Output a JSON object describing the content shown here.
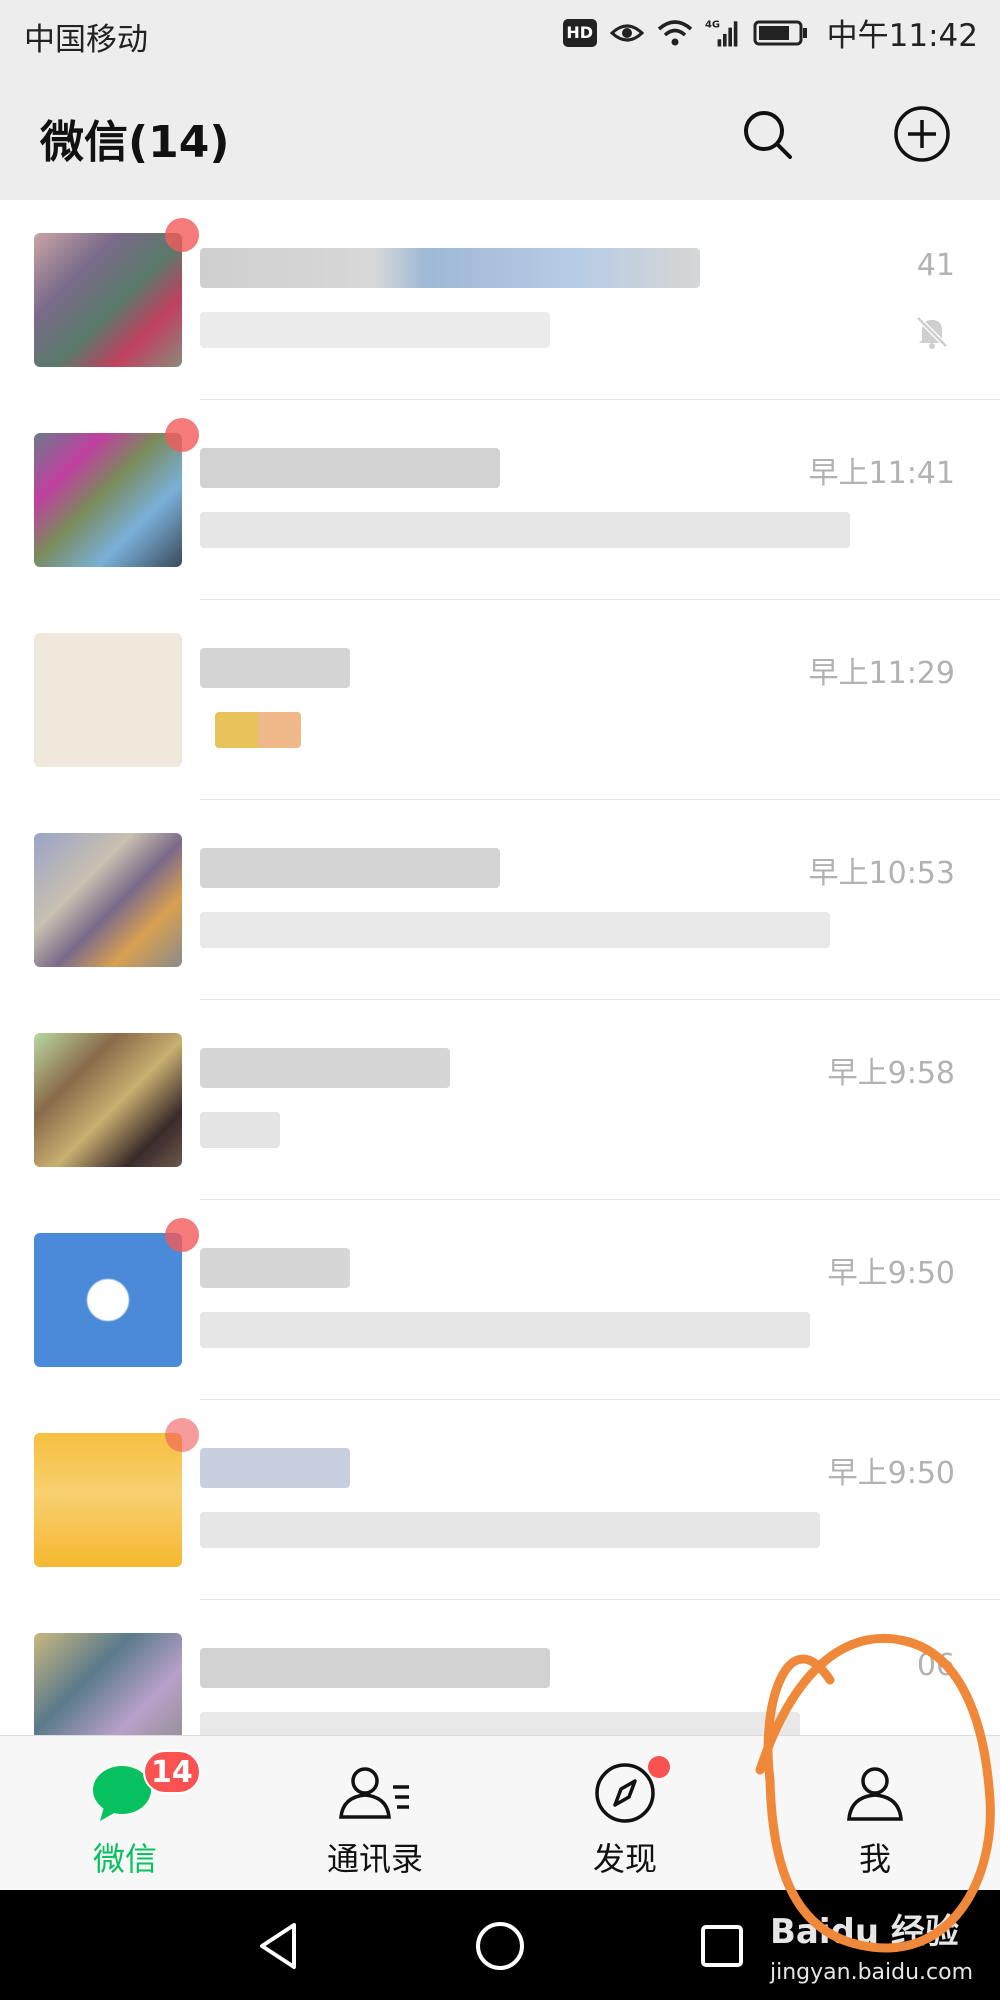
{
  "status_bar": {
    "carrier": "中国移动",
    "hd": "HD",
    "network": "4G",
    "time": "中午11:42"
  },
  "header": {
    "title": "微信(14)",
    "icons": [
      "search-icon",
      "add-icon"
    ]
  },
  "chats": [
    {
      "time": "41",
      "muted": true,
      "unread": true
    },
    {
      "time": "早上11:41",
      "muted": false,
      "unread": true
    },
    {
      "time": "早上11:29",
      "muted": false,
      "unread": false
    },
    {
      "time": "早上10:53",
      "muted": false,
      "unread": false
    },
    {
      "time": "早上9:58",
      "muted": false,
      "unread": false
    },
    {
      "time": "早上9:50",
      "muted": false,
      "unread": true
    },
    {
      "time": "早上9:50",
      "muted": false,
      "unread": true
    },
    {
      "time": "06",
      "muted": false,
      "unread": false
    }
  ],
  "tabs": [
    {
      "label": "微信",
      "badge": "14",
      "active": true,
      "icon": "chat-bubble-icon"
    },
    {
      "label": "通讯录",
      "active": false,
      "icon": "contacts-icon"
    },
    {
      "label": "发现",
      "active": false,
      "icon": "compass-icon",
      "dot": true
    },
    {
      "label": "我",
      "active": false,
      "icon": "person-icon"
    }
  ],
  "colors": {
    "accent": "#07c160",
    "badge": "#fa5151",
    "annotation": "#f0883a"
  },
  "watermark": {
    "brand": "Baidu 经验",
    "url": "jingyan.baidu.com"
  }
}
